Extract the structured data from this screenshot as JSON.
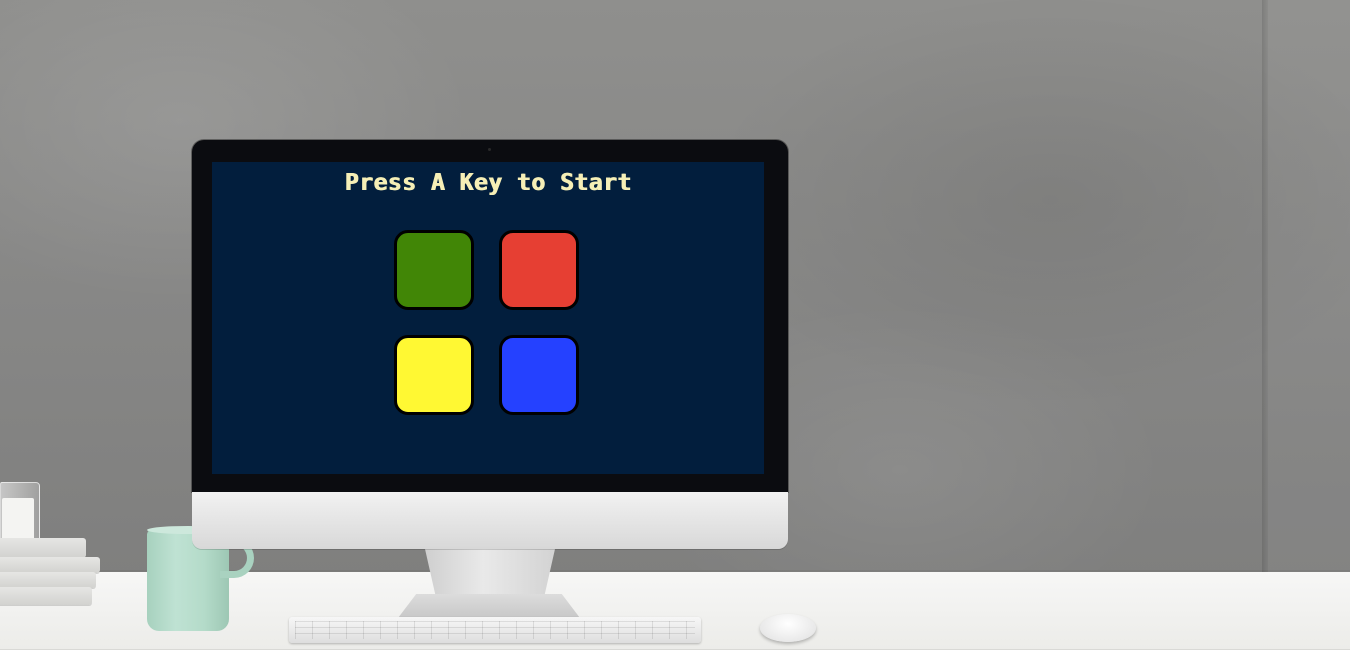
{
  "game": {
    "title": "Press A Key to Start",
    "pads": [
      {
        "id": "green",
        "color": "#418606"
      },
      {
        "id": "red",
        "color": "#e63f33"
      },
      {
        "id": "yellow",
        "color": "#fff833"
      },
      {
        "id": "blue",
        "color": "#2541ff"
      }
    ],
    "screen_background": "#021e3d",
    "title_color": "#f6efb6"
  }
}
